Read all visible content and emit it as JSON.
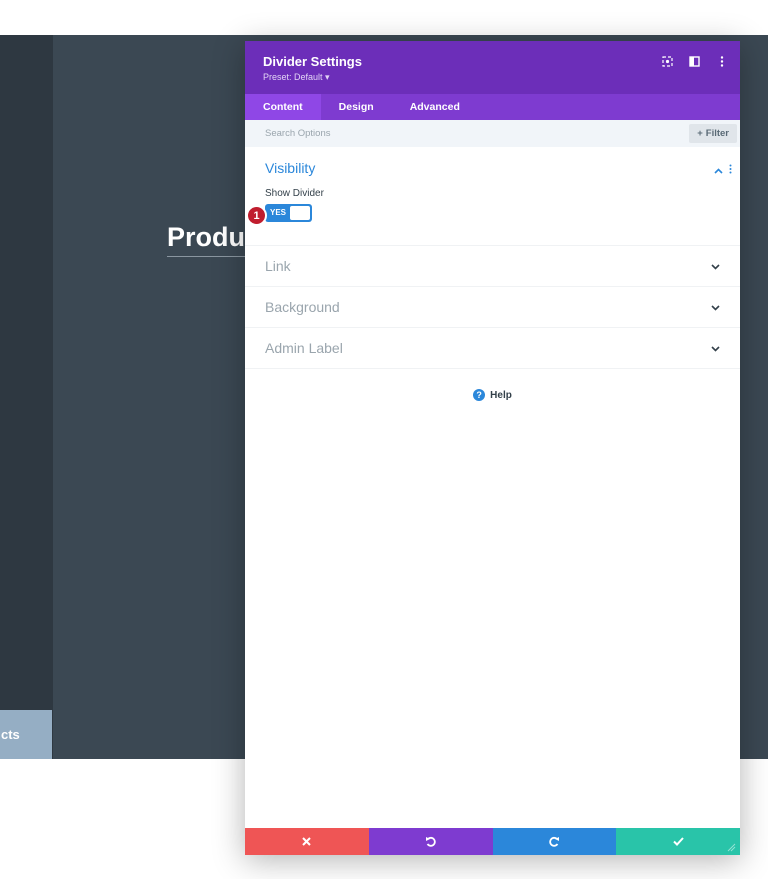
{
  "background": {
    "page_heading": "Products",
    "left_tab": "cts"
  },
  "modal": {
    "title": "Divider Settings",
    "preset": "Preset: Default ▾",
    "header_icons": [
      "screen-icon",
      "sidebar-icon",
      "more-icon"
    ],
    "tabs": [
      {
        "label": "Content",
        "active": true
      },
      {
        "label": "Design",
        "active": false
      },
      {
        "label": "Advanced",
        "active": false
      }
    ],
    "search": {
      "placeholder": "Search Options"
    },
    "filter": {
      "label": "Filter"
    },
    "sections": {
      "visibility": {
        "title": "Visibility",
        "field_label": "Show Divider",
        "toggle_value": "YES",
        "badge": "1"
      },
      "link": {
        "title": "Link"
      },
      "background": {
        "title": "Background"
      },
      "admin_label": {
        "title": "Admin Label"
      }
    },
    "help": {
      "label": "Help"
    }
  },
  "colors": {
    "header": "#6c2eb9",
    "tabs": "#7e3bd0",
    "accent_blue": "#2b87da",
    "discard": "#ef5555",
    "save": "#29c4a9",
    "badge": "#c01d2e"
  }
}
